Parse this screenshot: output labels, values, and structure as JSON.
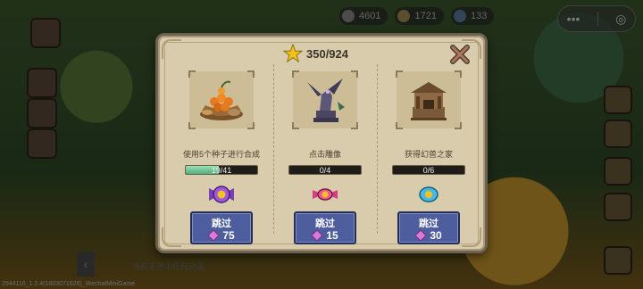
{
  "header": {
    "star_count": "350/924"
  },
  "topbar": {
    "res1": "4601",
    "res2": "1721",
    "res3": "133"
  },
  "bottom": {
    "message": "当前无进中任何动画",
    "build": "2944116_1.2.4(1803071626)_WechatMiniGame"
  },
  "tasks": [
    {
      "description": "使用5个种子进行合成",
      "progress": "19/41",
      "progress_fraction": 0.463,
      "skip_label": "跳过",
      "cost": "75",
      "image": "seed-basket-icon",
      "reward": "purple-candy-icon"
    },
    {
      "description": "点击雕像",
      "progress": "0/4",
      "progress_fraction": 0,
      "skip_label": "跳过",
      "cost": "15",
      "image": "dragon-statue-icon",
      "reward": "pink-candy-icon"
    },
    {
      "description": "获得幻兽之家",
      "progress": "0/6",
      "progress_fraction": 0,
      "skip_label": "跳过",
      "cost": "30",
      "image": "beast-house-icon",
      "reward": "blue-coin-icon"
    }
  ],
  "colors": {
    "panel": "#d9ccad",
    "skip_button": "#4d5d9e",
    "progress_fill": "#4fb07c",
    "gem": "#c86cc8"
  }
}
